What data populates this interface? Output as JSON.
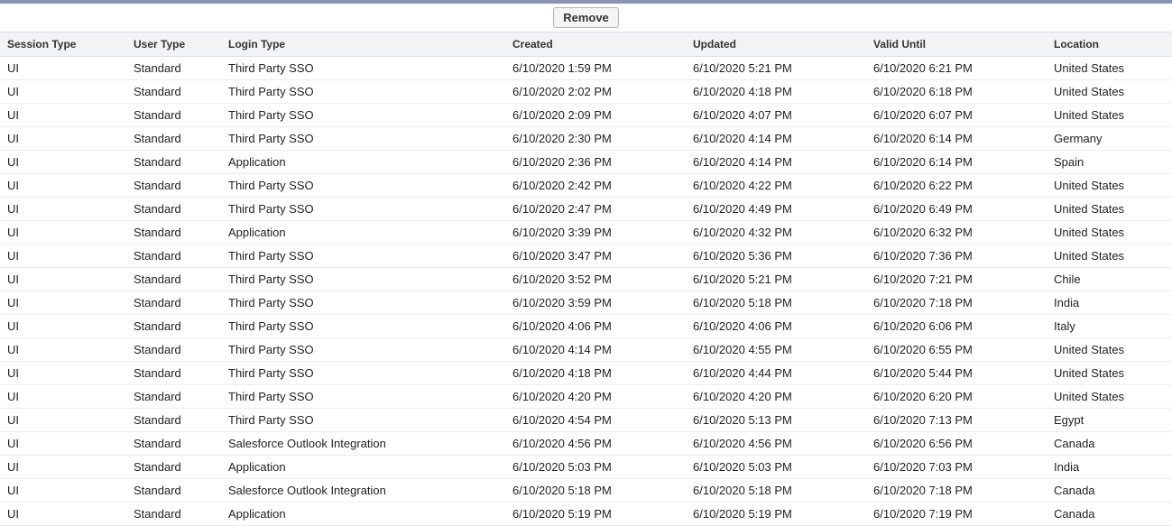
{
  "toolbar": {
    "remove_label": "Remove"
  },
  "table": {
    "headers": {
      "session_type": "Session Type",
      "user_type": "User Type",
      "login_type": "Login Type",
      "created": "Created",
      "updated": "Updated",
      "valid_until": "Valid Until",
      "location": "Location"
    },
    "rows": [
      {
        "session_type": "UI",
        "user_type": "Standard",
        "login_type": "Third Party SSO",
        "created": "6/10/2020 1:59 PM",
        "updated": "6/10/2020 5:21 PM",
        "valid_until": "6/10/2020 6:21 PM",
        "location": "United States"
      },
      {
        "session_type": "UI",
        "user_type": "Standard",
        "login_type": "Third Party SSO",
        "created": "6/10/2020 2:02 PM",
        "updated": "6/10/2020 4:18 PM",
        "valid_until": "6/10/2020 6:18 PM",
        "location": "United States"
      },
      {
        "session_type": "UI",
        "user_type": "Standard",
        "login_type": "Third Party SSO",
        "created": "6/10/2020 2:09 PM",
        "updated": "6/10/2020 4:07 PM",
        "valid_until": "6/10/2020 6:07 PM",
        "location": "United States"
      },
      {
        "session_type": "UI",
        "user_type": "Standard",
        "login_type": "Third Party SSO",
        "created": "6/10/2020 2:30 PM",
        "updated": "6/10/2020 4:14 PM",
        "valid_until": "6/10/2020 6:14 PM",
        "location": "Germany"
      },
      {
        "session_type": "UI",
        "user_type": "Standard",
        "login_type": "Application",
        "created": "6/10/2020 2:36 PM",
        "updated": "6/10/2020 4:14 PM",
        "valid_until": "6/10/2020 6:14 PM",
        "location": "Spain"
      },
      {
        "session_type": "UI",
        "user_type": "Standard",
        "login_type": "Third Party SSO",
        "created": "6/10/2020 2:42 PM",
        "updated": "6/10/2020 4:22 PM",
        "valid_until": "6/10/2020 6:22 PM",
        "location": "United States"
      },
      {
        "session_type": "UI",
        "user_type": "Standard",
        "login_type": "Third Party SSO",
        "created": "6/10/2020 2:47 PM",
        "updated": "6/10/2020 4:49 PM",
        "valid_until": "6/10/2020 6:49 PM",
        "location": "United States"
      },
      {
        "session_type": "UI",
        "user_type": "Standard",
        "login_type": "Application",
        "created": "6/10/2020 3:39 PM",
        "updated": "6/10/2020 4:32 PM",
        "valid_until": "6/10/2020 6:32 PM",
        "location": "United States"
      },
      {
        "session_type": "UI",
        "user_type": "Standard",
        "login_type": "Third Party SSO",
        "created": "6/10/2020 3:47 PM",
        "updated": "6/10/2020 5:36 PM",
        "valid_until": "6/10/2020 7:36 PM",
        "location": "United States"
      },
      {
        "session_type": "UI",
        "user_type": "Standard",
        "login_type": "Third Party SSO",
        "created": "6/10/2020 3:52 PM",
        "updated": "6/10/2020 5:21 PM",
        "valid_until": "6/10/2020 7:21 PM",
        "location": "Chile"
      },
      {
        "session_type": "UI",
        "user_type": "Standard",
        "login_type": "Third Party SSO",
        "created": "6/10/2020 3:59 PM",
        "updated": "6/10/2020 5:18 PM",
        "valid_until": "6/10/2020 7:18 PM",
        "location": "India"
      },
      {
        "session_type": "UI",
        "user_type": "Standard",
        "login_type": "Third Party SSO",
        "created": "6/10/2020 4:06 PM",
        "updated": "6/10/2020 4:06 PM",
        "valid_until": "6/10/2020 6:06 PM",
        "location": "Italy"
      },
      {
        "session_type": "UI",
        "user_type": "Standard",
        "login_type": "Third Party SSO",
        "created": "6/10/2020 4:14 PM",
        "updated": "6/10/2020 4:55 PM",
        "valid_until": "6/10/2020 6:55 PM",
        "location": "United States"
      },
      {
        "session_type": "UI",
        "user_type": "Standard",
        "login_type": "Third Party SSO",
        "created": "6/10/2020 4:18 PM",
        "updated": "6/10/2020 4:44 PM",
        "valid_until": "6/10/2020 5:44 PM",
        "location": "United States"
      },
      {
        "session_type": "UI",
        "user_type": "Standard",
        "login_type": "Third Party SSO",
        "created": "6/10/2020 4:20 PM",
        "updated": "6/10/2020 4:20 PM",
        "valid_until": "6/10/2020 6:20 PM",
        "location": "United States"
      },
      {
        "session_type": "UI",
        "user_type": "Standard",
        "login_type": "Third Party SSO",
        "created": "6/10/2020 4:54 PM",
        "updated": "6/10/2020 5:13 PM",
        "valid_until": "6/10/2020 7:13 PM",
        "location": "Egypt"
      },
      {
        "session_type": "UI",
        "user_type": "Standard",
        "login_type": "Salesforce Outlook Integration",
        "created": "6/10/2020 4:56 PM",
        "updated": "6/10/2020 4:56 PM",
        "valid_until": "6/10/2020 6:56 PM",
        "location": "Canada"
      },
      {
        "session_type": "UI",
        "user_type": "Standard",
        "login_type": "Application",
        "created": "6/10/2020 5:03 PM",
        "updated": "6/10/2020 5:03 PM",
        "valid_until": "6/10/2020 7:03 PM",
        "location": "India"
      },
      {
        "session_type": "UI",
        "user_type": "Standard",
        "login_type": "Salesforce Outlook Integration",
        "created": "6/10/2020 5:18 PM",
        "updated": "6/10/2020 5:18 PM",
        "valid_until": "6/10/2020 7:18 PM",
        "location": "Canada"
      },
      {
        "session_type": "UI",
        "user_type": "Standard",
        "login_type": "Application",
        "created": "6/10/2020 5:19 PM",
        "updated": "6/10/2020 5:19 PM",
        "valid_until": "6/10/2020 7:19 PM",
        "location": "Canada"
      }
    ]
  }
}
